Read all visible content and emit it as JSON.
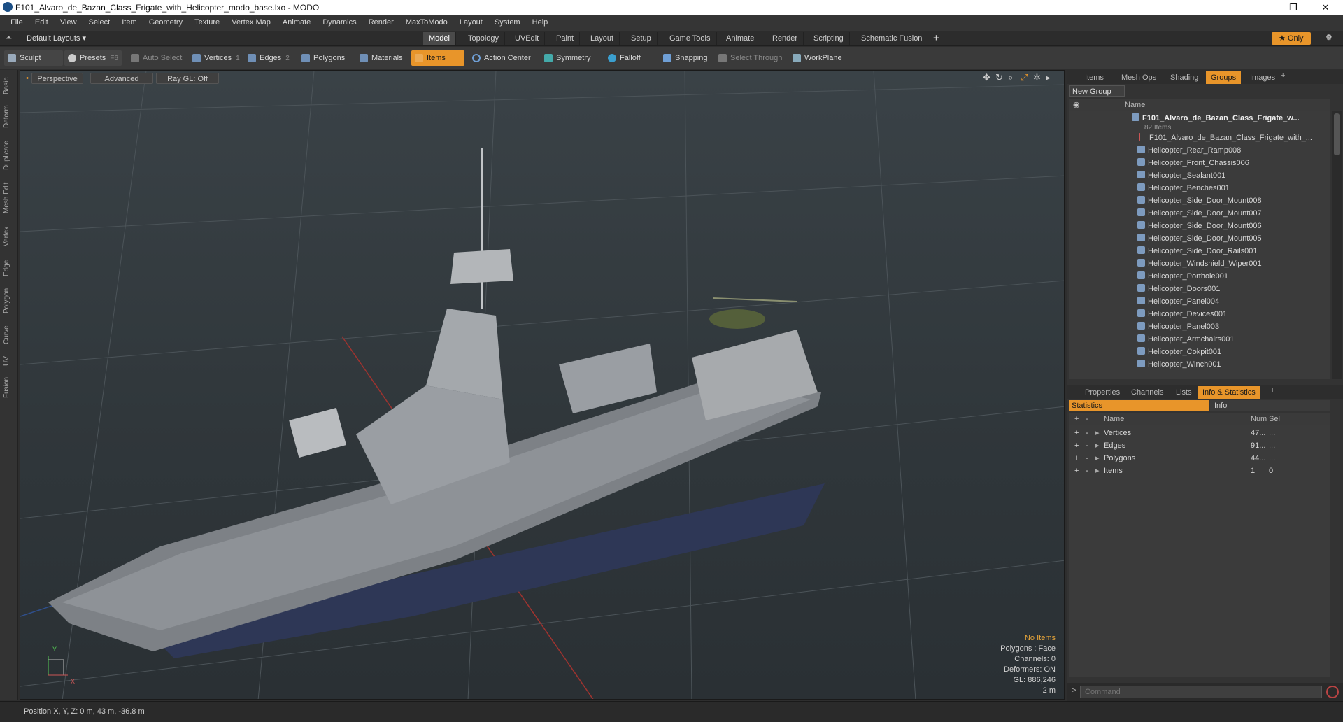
{
  "window": {
    "title": "F101_Alvaro_de_Bazan_Class_Frigate_with_Helicopter_modo_base.lxo - MODO",
    "min": "—",
    "max": "❐",
    "close": "✕"
  },
  "menu": [
    "File",
    "Edit",
    "View",
    "Select",
    "Item",
    "Geometry",
    "Texture",
    "Vertex Map",
    "Animate",
    "Dynamics",
    "Render",
    "MaxToModo",
    "Layout",
    "System",
    "Help"
  ],
  "layoutbar": {
    "layouts_label": "Default Layouts",
    "tabs": [
      "Model",
      "Topology",
      "UVEdit",
      "Paint",
      "Layout",
      "Setup",
      "Game Tools",
      "Animate",
      "Render",
      "Scripting",
      "Schematic Fusion"
    ],
    "active_tab": "Model",
    "plus": "+",
    "only_label": "Only"
  },
  "toolbar": {
    "sculpt": "Sculpt",
    "presets": "Presets",
    "presets_key": "F6",
    "auto_select": "Auto Select",
    "vertices": "Vertices",
    "vertices_num": "1",
    "edges": "Edges",
    "edges_num": "2",
    "polygons": "Polygons",
    "materials": "Materials",
    "items": "Items",
    "action_center": "Action Center",
    "symmetry": "Symmetry",
    "falloff": "Falloff",
    "snapping": "Snapping",
    "select_through": "Select Through",
    "workplane": "WorkPlane"
  },
  "left_tabs": [
    "Basic",
    "Deform",
    "Duplicate",
    "Mesh Edit",
    "Vertex",
    "Edge",
    "Polygon",
    "Curve",
    "UV",
    "Fusion"
  ],
  "viewport": {
    "perspective": "Perspective",
    "advanced": "Advanced",
    "raygl": "Ray GL: Off",
    "info": {
      "no_items": "No Items",
      "polygons": "Polygons : Face",
      "channels": "Channels: 0",
      "deformers": "Deformers: ON",
      "gl": "GL: 886,246",
      "scale": "2 m"
    },
    "axis_y": "Y",
    "axis_x": "X"
  },
  "statusbar": {
    "position": "Position X, Y, Z:   0 m, 43 m, -36.8 m"
  },
  "groups_panel": {
    "tabs": [
      "Items",
      "Mesh Ops",
      "Shading",
      "Groups",
      "Images"
    ],
    "active": "Groups",
    "new_group": "New Group",
    "col_name": "Name",
    "root": "F101_Alvaro_de_Bazan_Class_Frigate_w...",
    "root_count": "82 Items",
    "items": [
      "F101_Alvaro_de_Bazan_Class_Frigate_with_...",
      "Helicopter_Rear_Ramp008",
      "Helicopter_Front_Chassis006",
      "Helicopter_Sealant001",
      "Helicopter_Benches001",
      "Helicopter_Side_Door_Mount008",
      "Helicopter_Side_Door_Mount007",
      "Helicopter_Side_Door_Mount006",
      "Helicopter_Side_Door_Mount005",
      "Helicopter_Side_Door_Rails001",
      "Helicopter_Windshield_Wiper001",
      "Helicopter_Porthole001",
      "Helicopter_Doors001",
      "Helicopter_Panel004",
      "Helicopter_Devices001",
      "Helicopter_Panel003",
      "Helicopter_Armchairs001",
      "Helicopter_Cokpit001",
      "Helicopter_Winch001"
    ]
  },
  "stats_panel": {
    "tabs": [
      "Properties",
      "Channels",
      "Lists",
      "Info & Statistics"
    ],
    "active": "Info & Statistics",
    "sub_tabs": [
      "Statistics",
      "Info"
    ],
    "col_name": "Name",
    "col_num": "Num",
    "col_sel": "Sel",
    "rows": [
      {
        "name": "Vertices",
        "num": "47...",
        "sel": "..."
      },
      {
        "name": "Edges",
        "num": "91...",
        "sel": "..."
      },
      {
        "name": "Polygons",
        "num": "44...",
        "sel": "..."
      },
      {
        "name": "Items",
        "num": "1",
        "sel": "0"
      }
    ]
  },
  "command": {
    "placeholder": "Command",
    "prompt": ">"
  }
}
